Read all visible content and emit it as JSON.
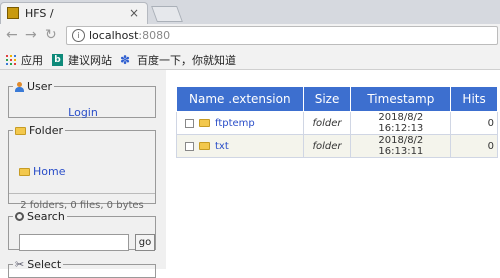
{
  "browser": {
    "tab_title": "HFS /",
    "address": {
      "host": "localhost",
      "port": ":8080"
    },
    "bookmarks": [
      "应用",
      "建议网站",
      "百度一下，你就知道"
    ]
  },
  "sidebar": {
    "user": {
      "legend": "User",
      "login": "Login"
    },
    "folder": {
      "legend": "Folder",
      "home": "Home",
      "stats": "2 folders, 0 files, 0 bytes"
    },
    "search": {
      "legend": "Search",
      "input_value": "",
      "go": "go"
    },
    "select": {
      "legend": "Select"
    }
  },
  "files": {
    "columns": [
      "Name .extension",
      "Size",
      "Timestamp",
      "Hits"
    ],
    "rows": [
      {
        "name": "ftptemp",
        "size": "folder",
        "timestamp": "2018/8/2 16:12:13",
        "hits": "0"
      },
      {
        "name": "txt",
        "size": "folder",
        "timestamp": "2018/8/2 16:13:11",
        "hits": "0"
      }
    ]
  }
}
